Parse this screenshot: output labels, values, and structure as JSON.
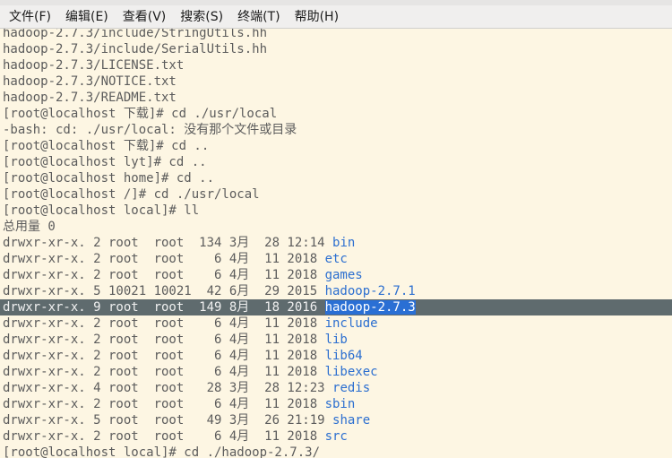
{
  "menubar": {
    "items": [
      "文件(F)",
      "编辑(E)",
      "查看(V)",
      "搜索(S)",
      "终端(T)",
      "帮助(H)"
    ]
  },
  "terminal": {
    "lines": [
      "hadoop-2.7.3/include/StringUtils.hh",
      "hadoop-2.7.3/include/SerialUtils.hh",
      "hadoop-2.7.3/LICENSE.txt",
      "hadoop-2.7.3/NOTICE.txt",
      "hadoop-2.7.3/README.txt",
      "[root@localhost 下载]# cd ./usr/local",
      "-bash: cd: ./usr/local: 没有那个文件或目录",
      "[root@localhost 下载]# cd ..",
      "[root@localhost lyt]# cd ..",
      "[root@localhost home]# cd ..",
      "[root@localhost /]# cd ./usr/local",
      "[root@localhost local]# ll",
      "总用量 0"
    ],
    "listing": [
      {
        "perm": "drwxr-xr-x. 2 root  root  134 3月  28 12:14 ",
        "name": "bin"
      },
      {
        "perm": "drwxr-xr-x. 2 root  root    6 4月  11 2018 ",
        "name": "etc"
      },
      {
        "perm": "drwxr-xr-x. 2 root  root    6 4月  11 2018 ",
        "name": "games"
      },
      {
        "perm": "drwxr-xr-x. 5 10021 10021  42 6月  29 2015 ",
        "name": "hadoop-2.7.1"
      },
      {
        "perm": "drwxr-xr-x. 9 root  root  149 8月  18 2016 ",
        "name": "hadoop-2.7.3",
        "selected": true
      },
      {
        "perm": "drwxr-xr-x. 2 root  root    6 4月  11 2018 ",
        "name": "include"
      },
      {
        "perm": "drwxr-xr-x. 2 root  root    6 4月  11 2018 ",
        "name": "lib"
      },
      {
        "perm": "drwxr-xr-x. 2 root  root    6 4月  11 2018 ",
        "name": "lib64"
      },
      {
        "perm": "drwxr-xr-x. 2 root  root    6 4月  11 2018 ",
        "name": "libexec"
      },
      {
        "perm": "drwxr-xr-x. 4 root  root   28 3月  28 12:23 ",
        "name": "redis"
      },
      {
        "perm": "drwxr-xr-x. 2 root  root    6 4月  11 2018 ",
        "name": "sbin"
      },
      {
        "perm": "drwxr-xr-x. 5 root  root   49 3月  26 21:19 ",
        "name": "share"
      },
      {
        "perm": "drwxr-xr-x. 2 root  root    6 4月  11 2018 ",
        "name": "src"
      }
    ],
    "last_line": "[root@localhost local]# cd ./hadoop-2.7.3/"
  },
  "colors": {
    "background": "#fdf6e3",
    "text": "#5c5c5c",
    "directory": "#2c6fd0",
    "selection_row": "#5f6b6e",
    "selection_name": "#2a6fd4"
  }
}
